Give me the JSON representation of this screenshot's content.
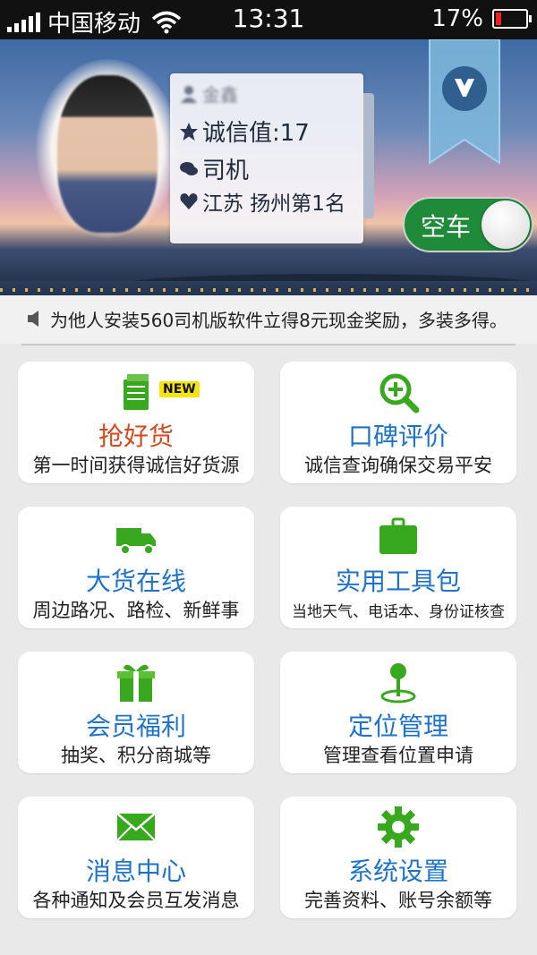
{
  "status_bar": {
    "carrier": "中国移动",
    "time": "13:31",
    "battery": "17%",
    "battery_level": 0.17
  },
  "profile": {
    "name_blurred": "金鑫",
    "integrity_score": "诚信值:17",
    "role": "司机",
    "ranking": "江苏 扬州第1名"
  },
  "status_toggle": {
    "label": "空车"
  },
  "notice": {
    "text": "为他人安装560司机版软件立得8元现金奖励，多装多得。"
  },
  "tiles": [
    {
      "title": "抢好货",
      "subtitle": "第一时间获得诚信好货源",
      "badge": "NEW",
      "icon": "document-stack-icon",
      "title_color": "#d24a1e"
    },
    {
      "title": "口碑评价",
      "subtitle": "诚信查询确保交易平安",
      "icon": "magnify-plus-icon",
      "title_color": "#1e73c8"
    },
    {
      "title": "大货在线",
      "subtitle": "周边路况、路检、新鲜事",
      "icon": "truck-icon",
      "title_color": "#1e73c8"
    },
    {
      "title": "实用工具包",
      "subtitle": "当地天气、电话本、身份证核查",
      "icon": "briefcase-icon",
      "title_color": "#1e73c8"
    },
    {
      "title": "会员福利",
      "subtitle": "抽奖、积分商城等",
      "icon": "gift-icon",
      "title_color": "#1e73c8"
    },
    {
      "title": "定位管理",
      "subtitle": "管理查看位置申请",
      "icon": "location-pin-icon",
      "title_color": "#1e73c8"
    },
    {
      "title": "消息中心",
      "subtitle": "各种通知及会员互发消息",
      "icon": "envelope-icon",
      "title_color": "#1e73c8"
    },
    {
      "title": "系统设置",
      "subtitle": "完善资料、账号余额等",
      "icon": "gear-icon",
      "title_color": "#1e73c8"
    }
  ],
  "colors": {
    "accent_green": "#38a81f",
    "title_blue": "#1e73c8",
    "toggle_green": "#1f8a3a"
  }
}
